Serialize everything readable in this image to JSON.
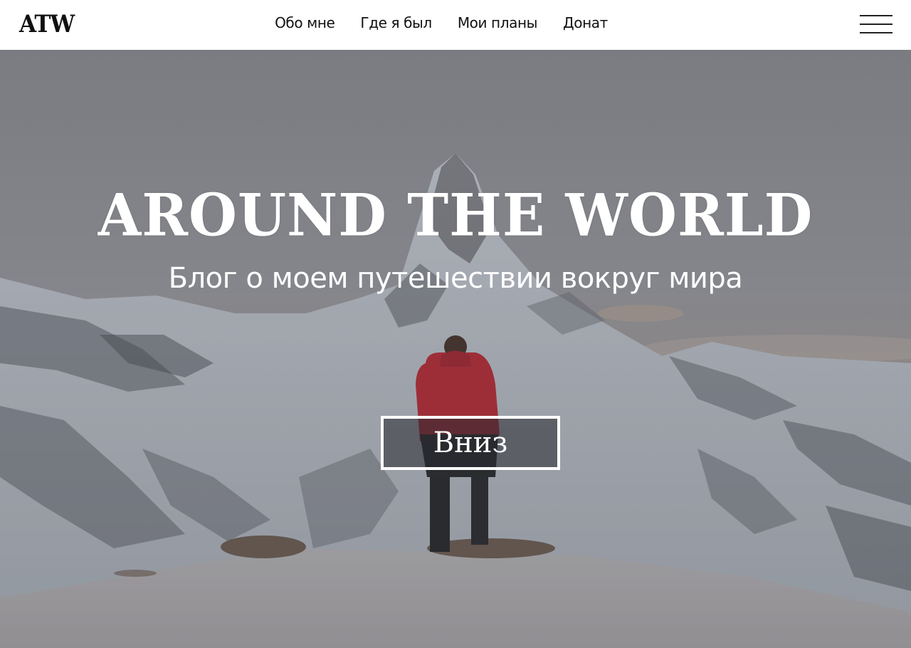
{
  "header": {
    "logo": "ATW",
    "nav": [
      {
        "label": "Обо мне"
      },
      {
        "label": "Где я был"
      },
      {
        "label": "Мои планы"
      },
      {
        "label": "Донат"
      }
    ],
    "menu_icon": "hamburger-menu-icon"
  },
  "hero": {
    "title": "AROUND THE WORLD",
    "subtitle": "Блог о моем путешествии вокруг мира",
    "button_label": "Вниз",
    "background": "mountain-hiker-photo"
  },
  "colors": {
    "header_bg": "#ffffff",
    "text_dark": "#111111",
    "hero_text": "#ffffff",
    "jacket_red": "#c0303a"
  }
}
